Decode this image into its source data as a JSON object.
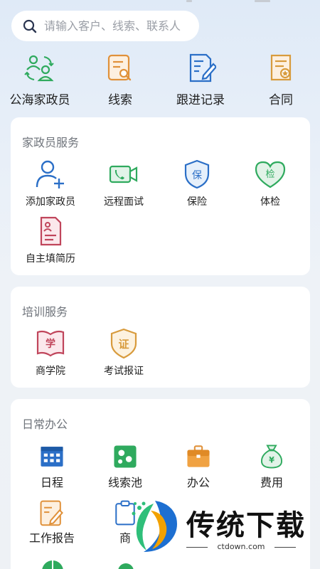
{
  "search": {
    "placeholder": "请输入客户、线索、联系人"
  },
  "quick_actions": [
    {
      "label": "公海家政员",
      "icon": "sea-workers-icon"
    },
    {
      "label": "线索",
      "icon": "lead-icon"
    },
    {
      "label": "跟进记录",
      "icon": "follow-up-record-icon"
    },
    {
      "label": "合同",
      "icon": "contract-icon"
    }
  ],
  "sections": {
    "worker_service": {
      "title": "家政员服务",
      "items": [
        {
          "label": "添加家政员",
          "icon": "add-person-icon"
        },
        {
          "label": "远程面试",
          "icon": "video-call-icon"
        },
        {
          "label": "保险",
          "icon": "insurance-shield-icon",
          "glyph": "保"
        },
        {
          "label": "体检",
          "icon": "health-check-heart-icon",
          "glyph": "检"
        },
        {
          "label": "自主填简历",
          "icon": "resume-icon"
        }
      ]
    },
    "training": {
      "title": "培训服务",
      "items": [
        {
          "label": "商学院",
          "icon": "business-school-icon",
          "glyph": "学"
        },
        {
          "label": "考试报证",
          "icon": "certificate-icon",
          "glyph": "证"
        }
      ]
    },
    "office": {
      "title": "日常办公",
      "items": [
        {
          "label": "日程",
          "icon": "calendar-icon"
        },
        {
          "label": "线索池",
          "icon": "lead-pool-icon"
        },
        {
          "label": "办公",
          "icon": "briefcase-icon"
        },
        {
          "label": "费用",
          "icon": "money-bag-icon",
          "glyph": "¥"
        },
        {
          "label": "工作报告",
          "icon": "work-report-icon"
        },
        {
          "label": "商",
          "icon": "business-icon"
        }
      ]
    }
  },
  "watermark": {
    "text": "传统下载",
    "sub": "ctdown.com"
  },
  "colors": {
    "green": "#2faa5e",
    "orange": "#e0913a",
    "blue": "#2b6fc7",
    "pink": "#c0455b",
    "gold": "#d89b3c"
  }
}
